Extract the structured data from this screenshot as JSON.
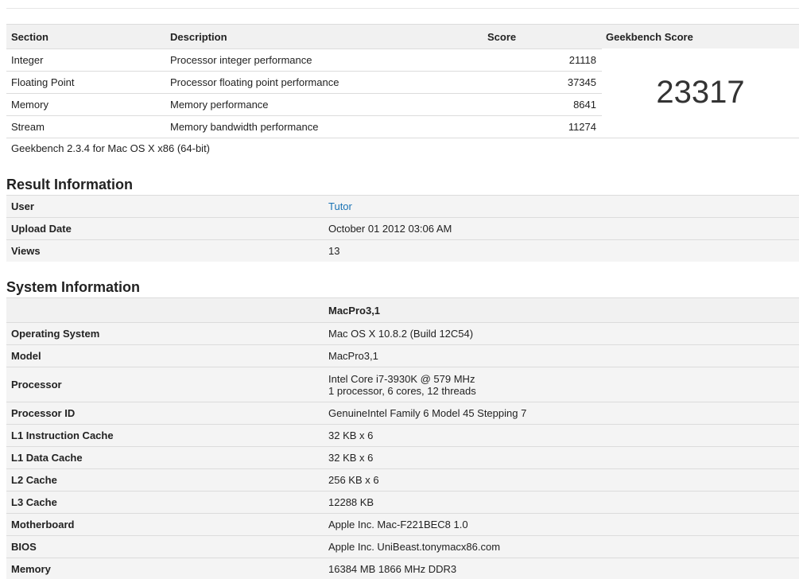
{
  "scores": {
    "headers": {
      "section": "Section",
      "description": "Description",
      "score": "Score",
      "geekbench_score": "Geekbench Score"
    },
    "rows": [
      {
        "section": "Integer",
        "description": "Processor integer performance",
        "score": "21118"
      },
      {
        "section": "Floating Point",
        "description": "Processor floating point performance",
        "score": "37345"
      },
      {
        "section": "Memory",
        "description": "Memory performance",
        "score": "8641"
      },
      {
        "section": "Stream",
        "description": "Memory bandwidth performance",
        "score": "11274"
      }
    ],
    "total": "23317",
    "footnote": "Geekbench 2.3.4 for Mac OS X x86 (64-bit)"
  },
  "result_info": {
    "title": "Result Information",
    "rows": [
      {
        "label": "User",
        "value": "Tutor"
      },
      {
        "label": "Upload Date",
        "value": "October 01 2012 03:06 AM"
      },
      {
        "label": "Views",
        "value": "13"
      }
    ]
  },
  "system_info": {
    "title": "System Information",
    "header_value": "MacPro3,1",
    "rows": [
      {
        "label": "Operating System",
        "value": "Mac OS X 10.8.2 (Build 12C54)"
      },
      {
        "label": "Model",
        "value": "MacPro3,1"
      },
      {
        "label": "Processor",
        "value": "Intel Core i7-3930K @ 579 MHz",
        "value2": "1 processor, 6 cores, 12 threads"
      },
      {
        "label": "Processor ID",
        "value": "GenuineIntel Family 6 Model 45 Stepping 7"
      },
      {
        "label": "L1 Instruction Cache",
        "value": "32 KB x 6"
      },
      {
        "label": "L1 Data Cache",
        "value": "32 KB x 6"
      },
      {
        "label": "L2 Cache",
        "value": "256 KB x 6"
      },
      {
        "label": "L3 Cache",
        "value": "12288 KB"
      },
      {
        "label": "Motherboard",
        "value": "Apple Inc. Mac-F221BEC8 1.0"
      },
      {
        "label": "BIOS",
        "value": "Apple Inc. UniBeast.tonymacx86.com"
      },
      {
        "label": "Memory",
        "value": "16384 MB 1866 MHz DDR3"
      }
    ]
  },
  "colors": {
    "link": "#1a73b5",
    "header_bg": "#f1f1f1",
    "shaded_bg": "#f4f4f4",
    "border": "#dcdcdc"
  }
}
